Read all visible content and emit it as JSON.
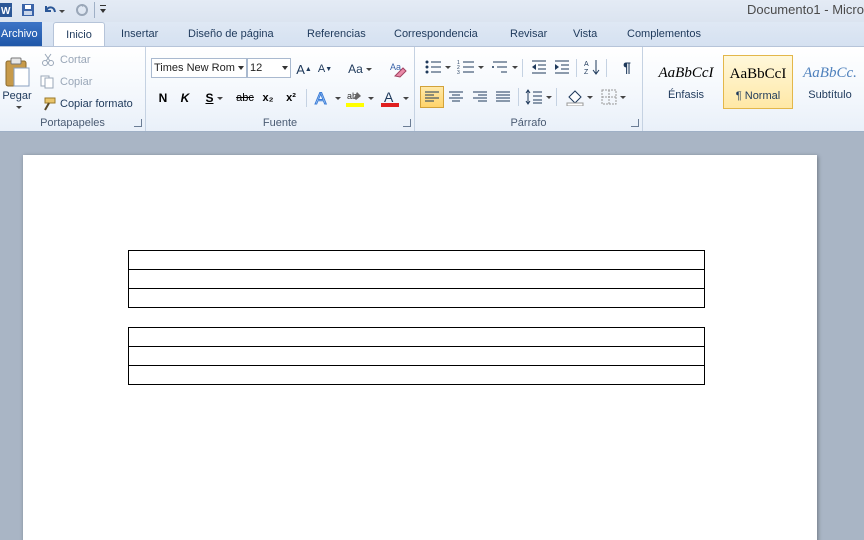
{
  "window": {
    "title": "Documento1 - Micro"
  },
  "tabs": {
    "file": "Archivo",
    "items": [
      "Inicio",
      "Insertar",
      "Diseño de página",
      "Referencias",
      "Correspondencia",
      "Revisar",
      "Vista",
      "Complementos"
    ],
    "active": "Inicio"
  },
  "clipboard": {
    "paste": "Pegar",
    "cut": "Cortar",
    "copy": "Copiar",
    "format_painter": "Copiar formato",
    "label": "Portapapeles"
  },
  "font": {
    "family": "Times New Rom",
    "size": "12",
    "bold": "N",
    "italic": "K",
    "underline": "S",
    "strike": "abc",
    "subscript": "x₂",
    "superscript": "x²",
    "grow": "A",
    "shrink": "A",
    "case": "Aa",
    "label": "Fuente"
  },
  "paragraph": {
    "label": "Párrafo"
  },
  "styles": [
    {
      "name": "Énfasis",
      "sample": "AaBbCcI"
    },
    {
      "name": "¶ Normal",
      "sample": "AaBbCcI"
    },
    {
      "name": "Subtítulo",
      "sample": "AaBbCc."
    }
  ],
  "document": {
    "tables": [
      {
        "rows": 3
      },
      {
        "rows": 3
      }
    ]
  }
}
